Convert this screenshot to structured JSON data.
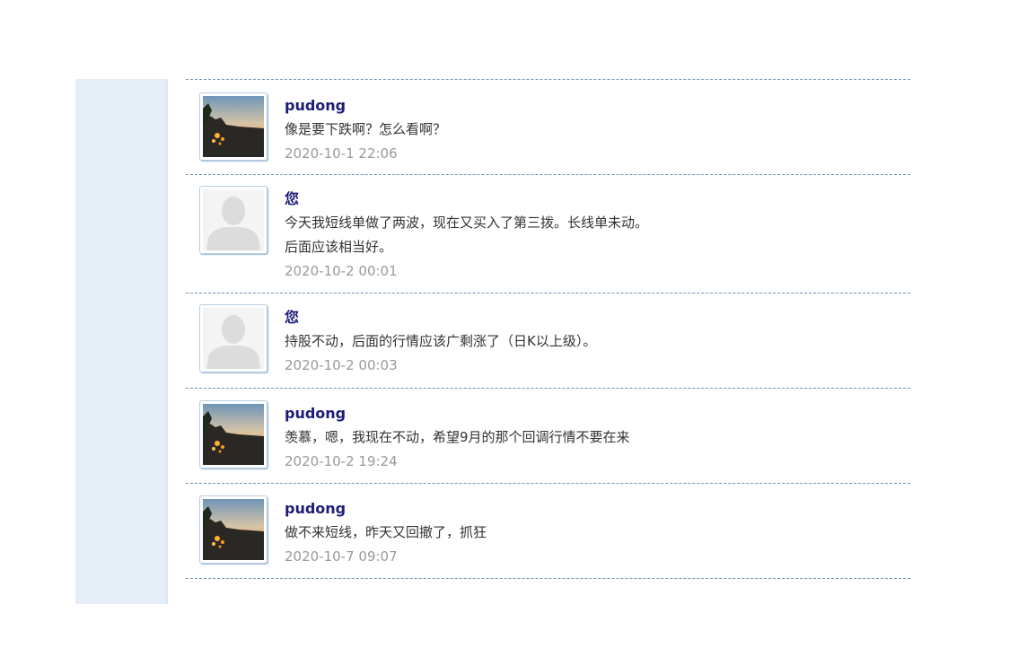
{
  "messages": [
    {
      "author": "pudong",
      "avatar": "photo-avatar",
      "lines": [
        "像是要下跌啊？怎么看啊？"
      ],
      "time": "2020-10-1 22:06"
    },
    {
      "author": "您",
      "avatar": "default-avatar",
      "lines": [
        "今天我短线单做了两波，现在又买入了第三拨。长线单未动。",
        "后面应该相当好。"
      ],
      "time": "2020-10-2 00:01"
    },
    {
      "author": "您",
      "avatar": "default-avatar",
      "lines": [
        "持股不动，后面的行情应该广剩涨了（日K以上级）。"
      ],
      "time": "2020-10-2 00:03"
    },
    {
      "author": "pudong",
      "avatar": "photo-avatar",
      "lines": [
        "羡慕，嗯，我现在不动，希望9月的那个回调行情不要在来"
      ],
      "time": "2020-10-2 19:24"
    },
    {
      "author": "pudong",
      "avatar": "photo-avatar",
      "lines": [
        "做不来短线，昨天又回撤了，抓狂"
      ],
      "time": "2020-10-7 09:07"
    }
  ]
}
